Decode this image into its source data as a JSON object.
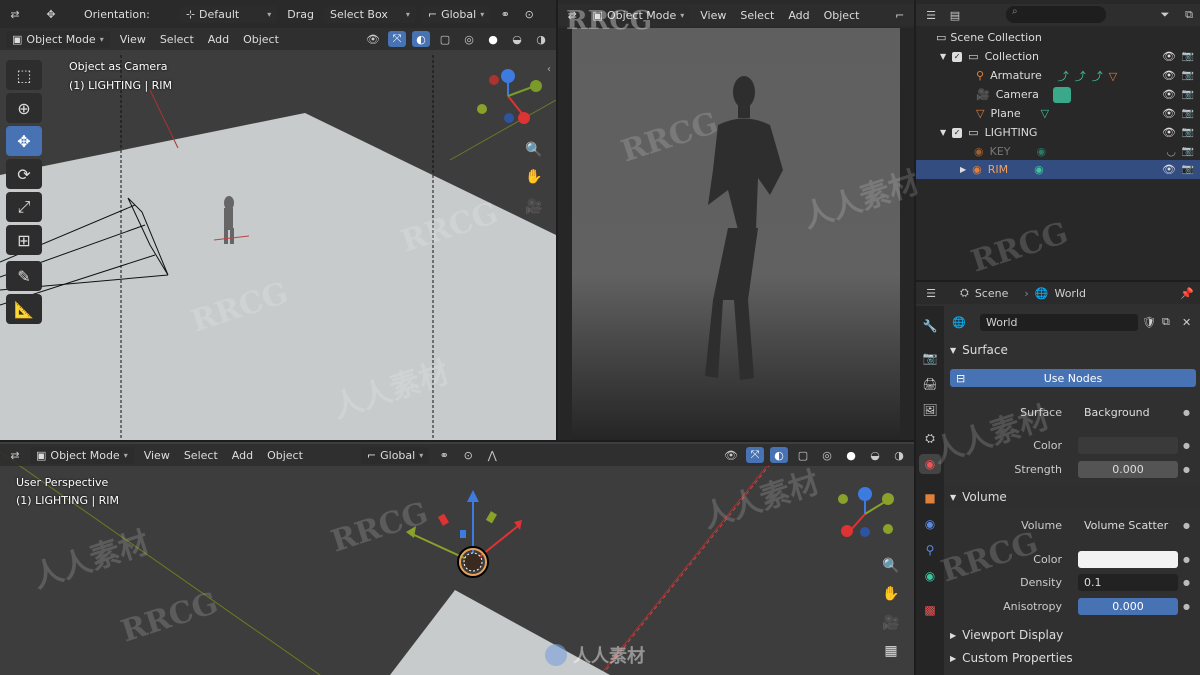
{
  "top_header": {
    "orientation_label": "Orientation:",
    "orientation_value": "Default",
    "drag_label": "Drag",
    "drag_value": "Select Box",
    "transform_space": "Global"
  },
  "viewport1": {
    "mode": "Object Mode",
    "menus": [
      "View",
      "Select",
      "Add",
      "Object"
    ],
    "overlay_line1": "Object as Camera",
    "overlay_line2": "(1) LIGHTING | RIM"
  },
  "viewport2": {
    "mode": "Object Mode",
    "menus": [
      "View",
      "Select",
      "Add",
      "Object"
    ]
  },
  "viewport3": {
    "mode": "Object Mode",
    "menus": [
      "View",
      "Select",
      "Add",
      "Object"
    ],
    "transform_space": "Global",
    "overlay_line1": "User Perspective",
    "overlay_line2": "(1) LIGHTING | RIM"
  },
  "outliner": {
    "scene_collection": "Scene Collection",
    "items": [
      {
        "label": "Collection"
      },
      {
        "label": "Armature"
      },
      {
        "label": "Camera"
      },
      {
        "label": "Plane"
      },
      {
        "label": "LIGHTING"
      },
      {
        "label": "KEY"
      },
      {
        "label": "RIM"
      }
    ]
  },
  "properties": {
    "scene_label": "Scene",
    "world_label": "World",
    "world_name": "World",
    "surface_section": "Surface",
    "use_nodes": "Use Nodes",
    "surface_label": "Surface",
    "surface_value": "Background",
    "color_label": "Color",
    "strength_label": "Strength",
    "strength_value": "0.000",
    "volume_section": "Volume",
    "volume_label": "Volume",
    "volume_value": "Volume Scatter",
    "vcolor_label": "Color",
    "density_label": "Density",
    "density_value": "0.1",
    "anisotropy_label": "Anisotropy",
    "anisotropy_value": "0.000",
    "viewport_display": "Viewport Display",
    "custom_properties": "Custom Properties"
  },
  "watermark": {
    "text1": "RRCG",
    "text2": "人人素材"
  }
}
